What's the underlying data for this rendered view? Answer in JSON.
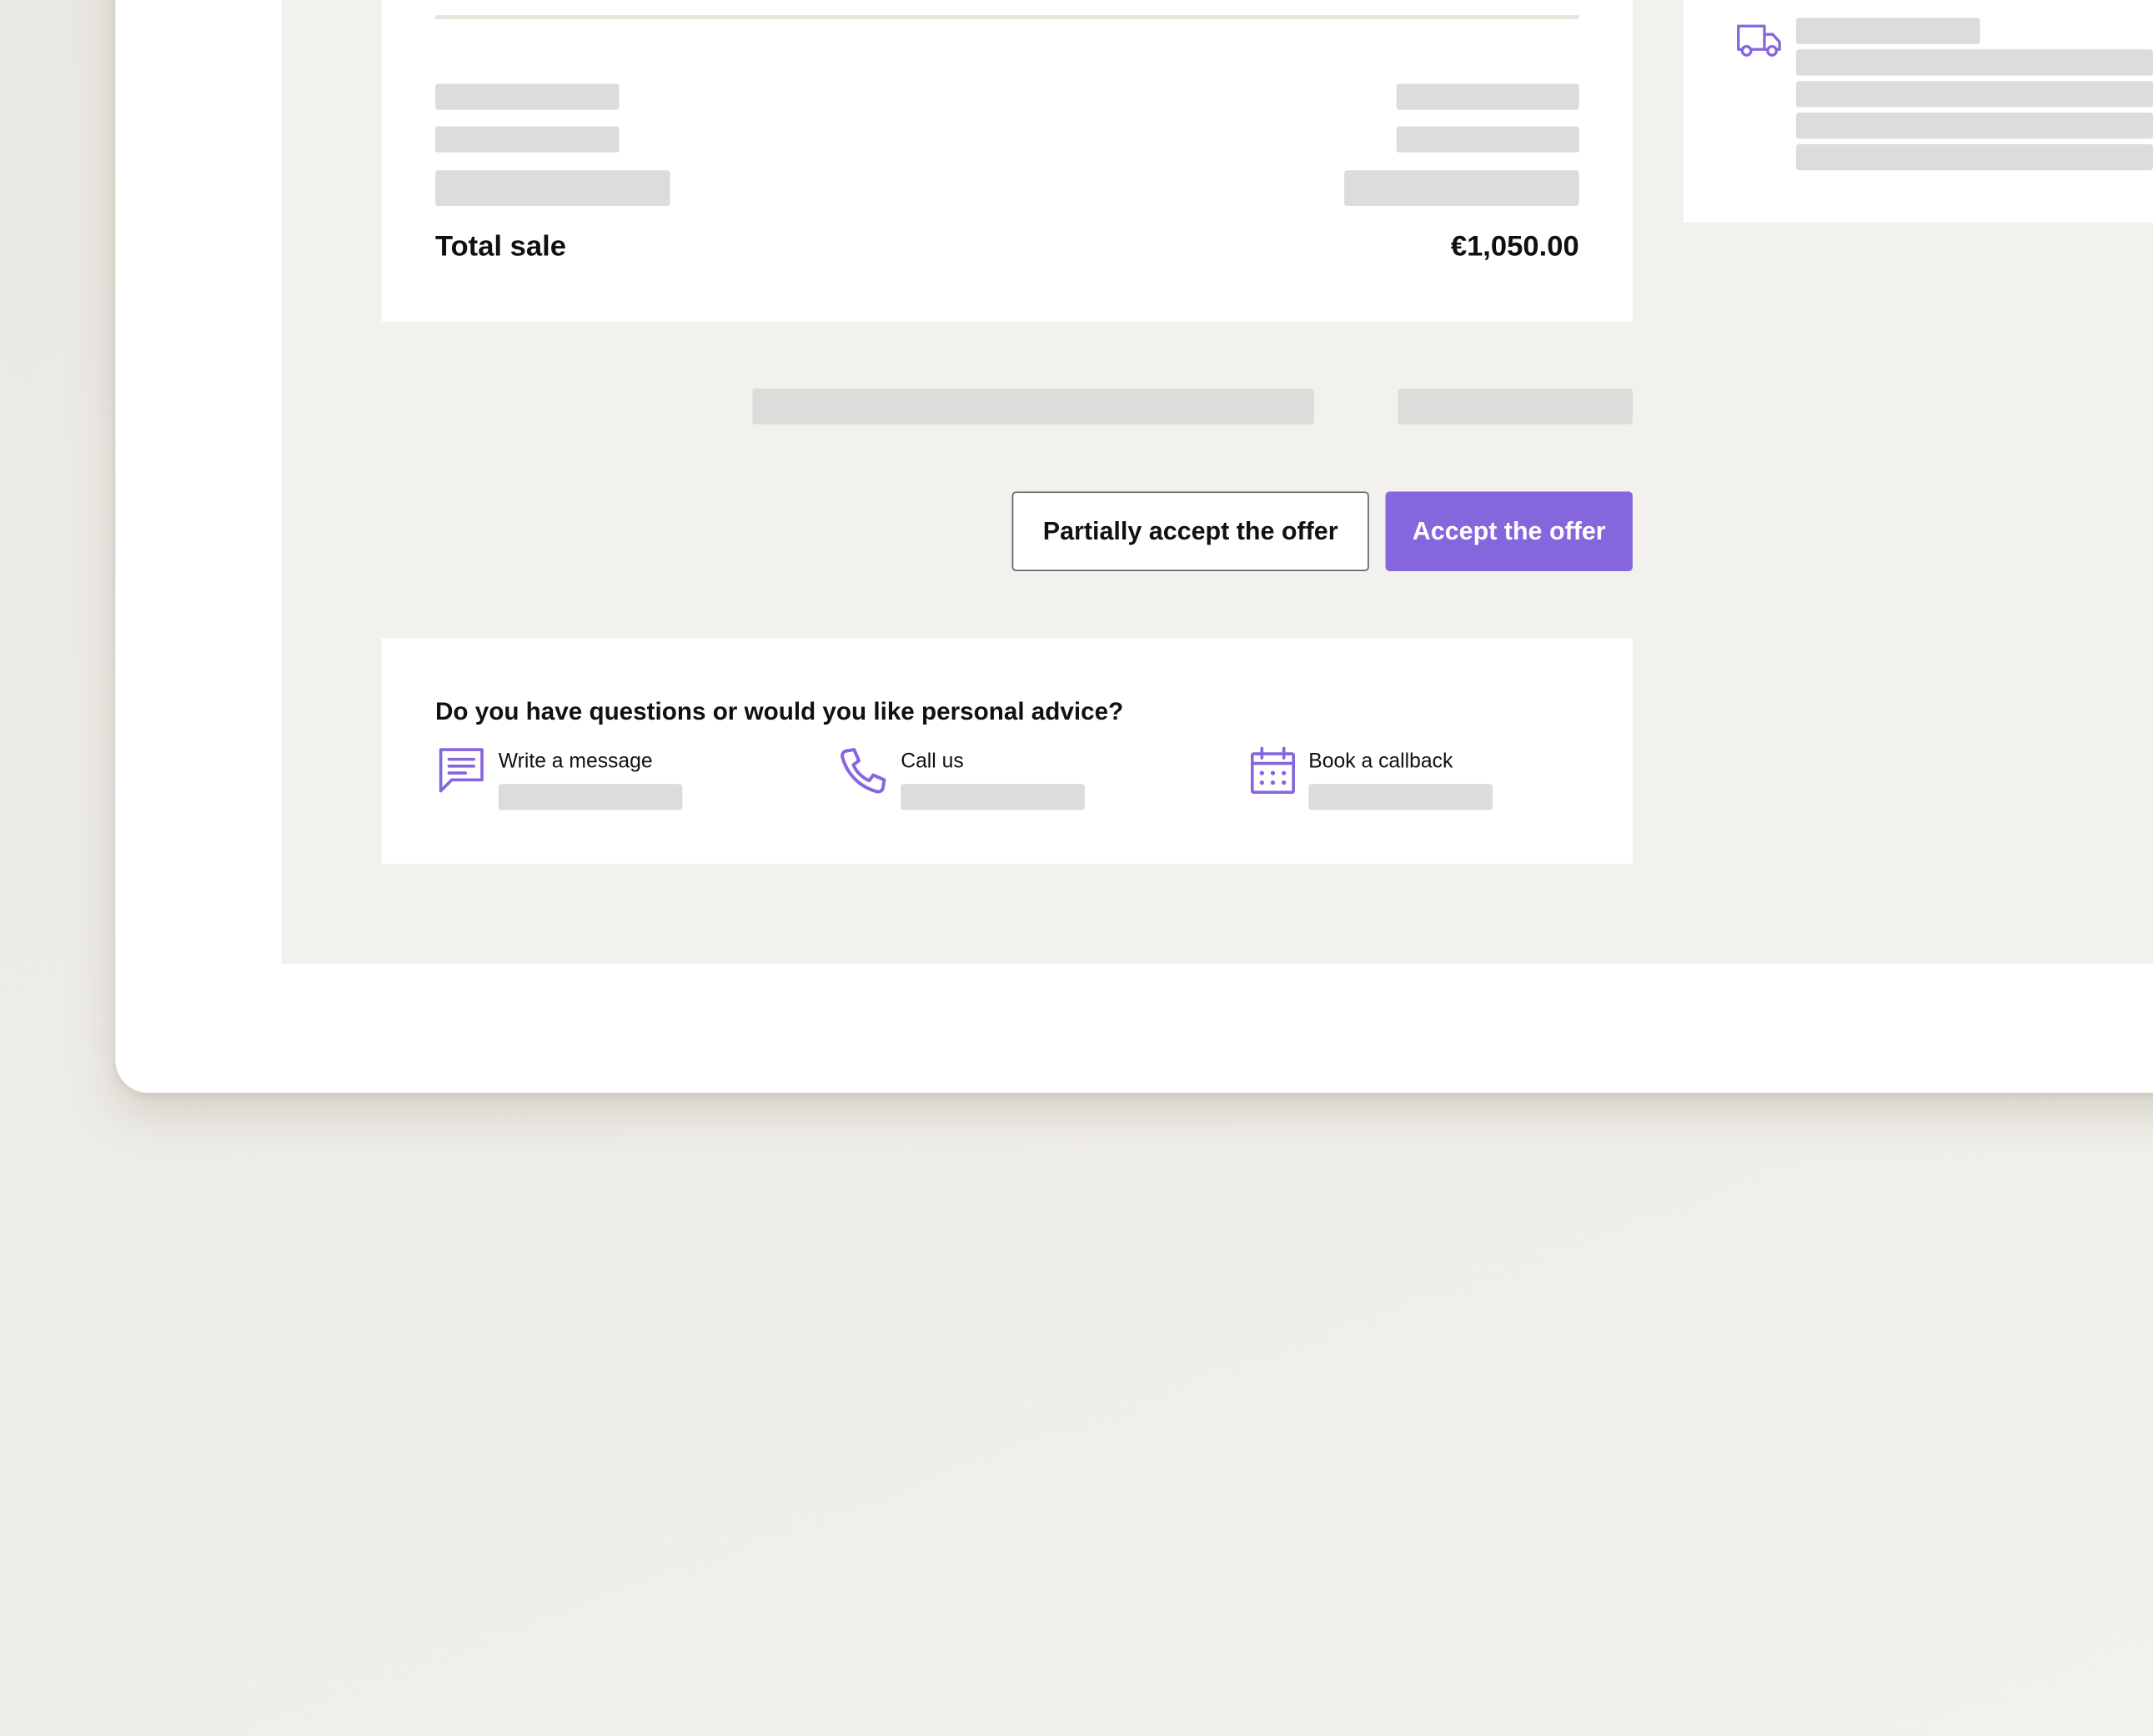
{
  "summary": {
    "total_label": "Total sale",
    "total_value": "€1,050.00"
  },
  "actions": {
    "partial_label": "Partially accept the offer",
    "accept_label": "Accept the offer"
  },
  "help": {
    "title": "Do you have questions or would you like personal advice?",
    "options": [
      {
        "label": "Write a message",
        "icon": "message-icon"
      },
      {
        "label": "Call us",
        "icon": "phone-icon"
      },
      {
        "label": "Book a callback",
        "icon": "calendar-icon"
      }
    ]
  },
  "shipping": {
    "icon": "truck-icon"
  },
  "colors": {
    "accent": "#8566dd",
    "placeholder": "#dcdcdb",
    "page_background": "#f2f1ed"
  }
}
